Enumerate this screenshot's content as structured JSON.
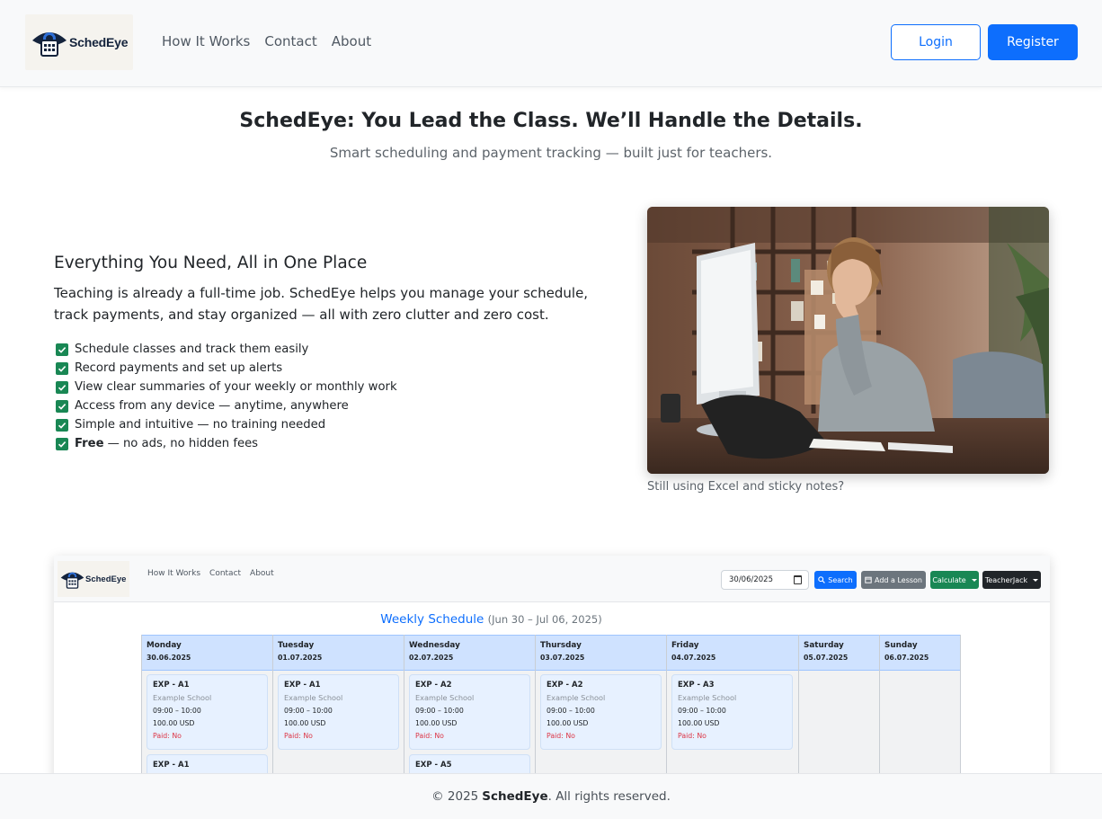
{
  "nav": {
    "brand": "SchedEye",
    "links": [
      "How It Works",
      "Contact",
      "About"
    ],
    "login": "Login",
    "register": "Register"
  },
  "hero": {
    "title": "SchedEye: You Lead the Class. We’ll Handle the Details.",
    "subtitle": "Smart scheduling and payment tracking — built just for teachers."
  },
  "features": {
    "title": "Everything You Need, All in One Place",
    "description": "Teaching is already a full-time job. SchedEye helps you manage your schedule, track payments, and stay organized — all with zero clutter and zero cost.",
    "items": [
      "Schedule classes and track them easily",
      "Record payments and set up alerts",
      "View clear summaries of your weekly or monthly work",
      "Access from any device — anytime, anywhere",
      "Simple and intuitive — no training needed"
    ],
    "last_item_bold": "Free",
    "last_item_rest": "— no ads, no hidden fees"
  },
  "photo": {
    "caption": "Still using Excel and sticky notes?"
  },
  "preview": {
    "brand": "SchedEye",
    "links": [
      "How It Works",
      "Contact",
      "About"
    ],
    "date_value": "30/06/2025",
    "search": "Search",
    "add_lesson": "Add a Lesson",
    "calculate": "Calculate",
    "user": "TeacherJack",
    "title": "Weekly Schedule",
    "range": "(Jun 30 – Jul 06, 2025)",
    "days": [
      {
        "name": "Monday",
        "date": "30.06.2025",
        "lessons": [
          {
            "code": "EXP - A1",
            "school": "Example School",
            "time": "09:00 – 10:00",
            "amount": "100.00 USD",
            "paid": "Paid: No"
          },
          {
            "code": "EXP - A1",
            "school": "",
            "time": "",
            "amount": "",
            "paid": ""
          }
        ]
      },
      {
        "name": "Tuesday",
        "date": "01.07.2025",
        "lessons": [
          {
            "code": "EXP - A1",
            "school": "Example School",
            "time": "09:00 – 10:00",
            "amount": "100.00 USD",
            "paid": "Paid: No"
          }
        ]
      },
      {
        "name": "Wednesday",
        "date": "02.07.2025",
        "lessons": [
          {
            "code": "EXP - A2",
            "school": "Example School",
            "time": "09:00 – 10:00",
            "amount": "100.00 USD",
            "paid": "Paid: No"
          },
          {
            "code": "EXP - A5",
            "school": "",
            "time": "",
            "amount": "",
            "paid": ""
          }
        ]
      },
      {
        "name": "Thursday",
        "date": "03.07.2025",
        "lessons": [
          {
            "code": "EXP - A2",
            "school": "Example School",
            "time": "09:00 – 10:00",
            "amount": "100.00 USD",
            "paid": "Paid: No"
          }
        ]
      },
      {
        "name": "Friday",
        "date": "04.07.2025",
        "lessons": [
          {
            "code": "EXP - A3",
            "school": "Example School",
            "time": "09:00 – 10:00",
            "amount": "100.00 USD",
            "paid": "Paid: No"
          }
        ]
      },
      {
        "name": "Saturday",
        "date": "05.07.2025",
        "lessons": []
      },
      {
        "name": "Sunday",
        "date": "06.07.2025",
        "lessons": []
      }
    ]
  },
  "footer": {
    "copy": "© 2025",
    "brand": "SchedEye",
    "rest": ". All rights reserved."
  },
  "colors": {
    "primary": "#0d6efd",
    "success": "#198754",
    "danger": "#dc3545",
    "brand_navy": "#14233c"
  }
}
